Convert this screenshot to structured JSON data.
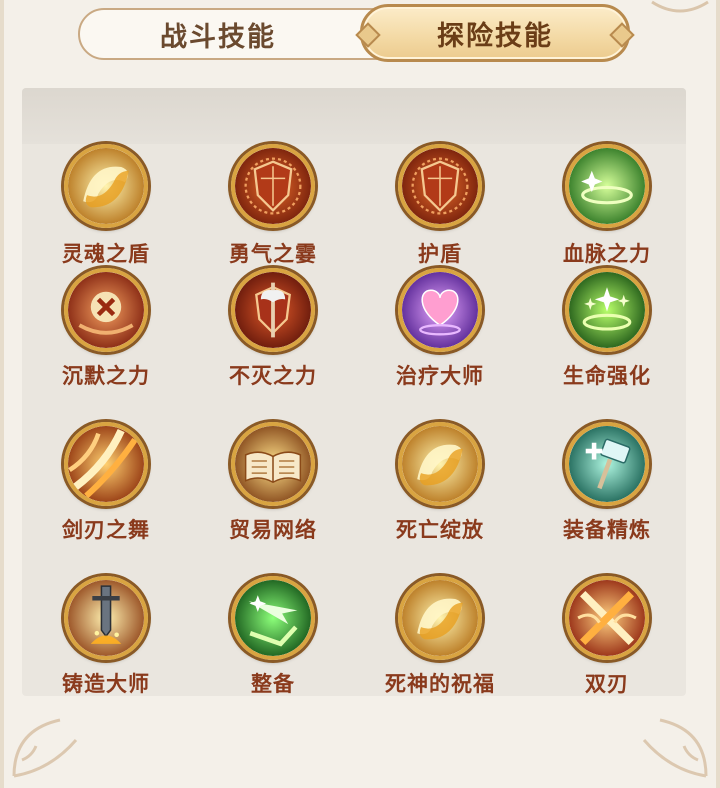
{
  "tabs": [
    {
      "label": "战斗技能",
      "active": false
    },
    {
      "label": "探险技能",
      "active": true
    }
  ],
  "skills": [
    {
      "name": "灵魂之盾",
      "icon": "golden-swirl-icon"
    },
    {
      "name": "勇气之霎",
      "icon": "red-shield-icon"
    },
    {
      "name": "护盾",
      "icon": "red-shield-icon"
    },
    {
      "name": "血脉之力",
      "icon": "green-aura-icon"
    },
    {
      "name": "沉默之力",
      "icon": "silence-cross-icon"
    },
    {
      "name": "不灭之力",
      "icon": "axe-shield-icon"
    },
    {
      "name": "治疗大师",
      "icon": "pink-heart-icon"
    },
    {
      "name": "生命强化",
      "icon": "green-sparkle-icon"
    },
    {
      "name": "剑刃之舞",
      "icon": "blade-slash-icon"
    },
    {
      "name": "贸易网络",
      "icon": "open-book-icon"
    },
    {
      "name": "死亡绽放",
      "icon": "golden-swirl-icon"
    },
    {
      "name": "装备精炼",
      "icon": "teal-hammer-icon"
    },
    {
      "name": "铸造大师",
      "icon": "forge-sword-icon"
    },
    {
      "name": "整备",
      "icon": "green-arrow-icon"
    },
    {
      "name": "死神的祝福",
      "icon": "golden-swirl-icon"
    },
    {
      "name": "双刃",
      "icon": "crossed-blades-icon"
    }
  ],
  "colors": {
    "tab_active_bg": "#f3d9a4",
    "skill_name": "#8a3a1c",
    "icon_ring": "#d9a441"
  }
}
